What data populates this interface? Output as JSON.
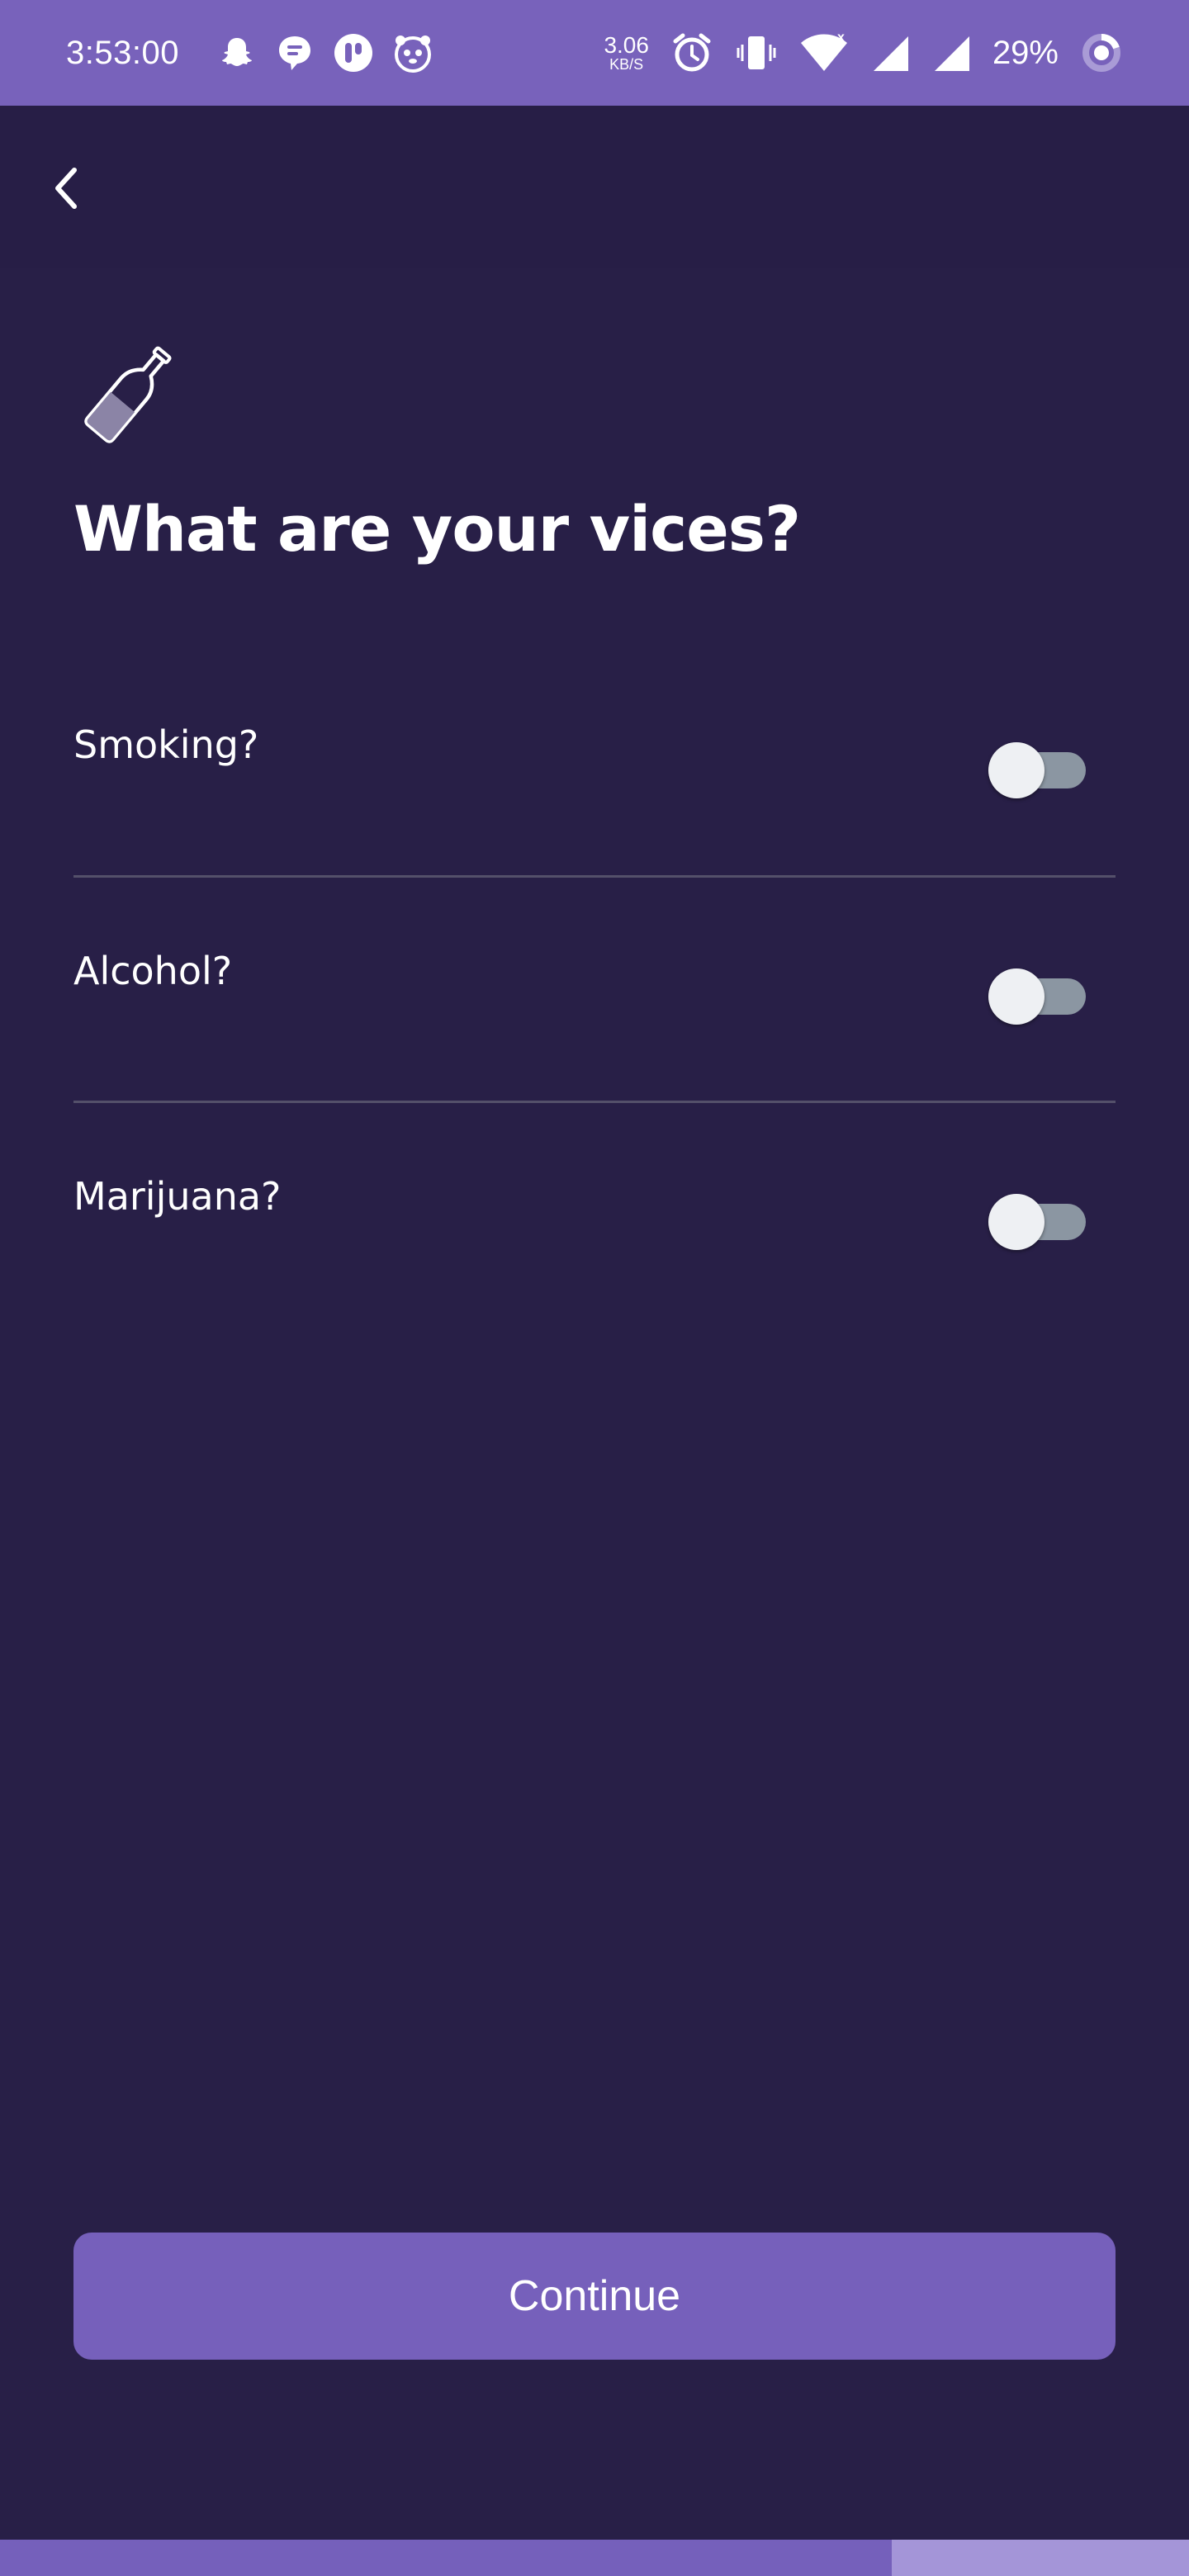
{
  "status_bar": {
    "time": "3:53:00",
    "net_speed_value": "3.06",
    "net_speed_unit": "KB/S",
    "battery": "29%",
    "left_icons": [
      "snapchat-icon",
      "chat-icon",
      "app-icon",
      "foodpanda-icon"
    ],
    "right_icons": [
      "alarm-icon",
      "vibrate-icon",
      "wifi-icon",
      "signal-icon",
      "signal-icon",
      "battery-ring-icon"
    ]
  },
  "nav": {
    "back_icon": "chevron-left-icon"
  },
  "header": {
    "icon": "bottle-icon",
    "title": "What are your vices?"
  },
  "options": [
    {
      "label": "Smoking?",
      "enabled": false
    },
    {
      "label": "Alcohol?",
      "enabled": false
    },
    {
      "label": "Marijuana?",
      "enabled": false
    }
  ],
  "footer": {
    "continue_label": "Continue"
  },
  "progress": {
    "fraction": 0.75
  },
  "colors": {
    "background": "#281f47",
    "status_bar": "#7862bb",
    "accent": "#7660bb",
    "toggle_track_off": "#8b96a2",
    "toggle_thumb": "#eef0f3"
  }
}
